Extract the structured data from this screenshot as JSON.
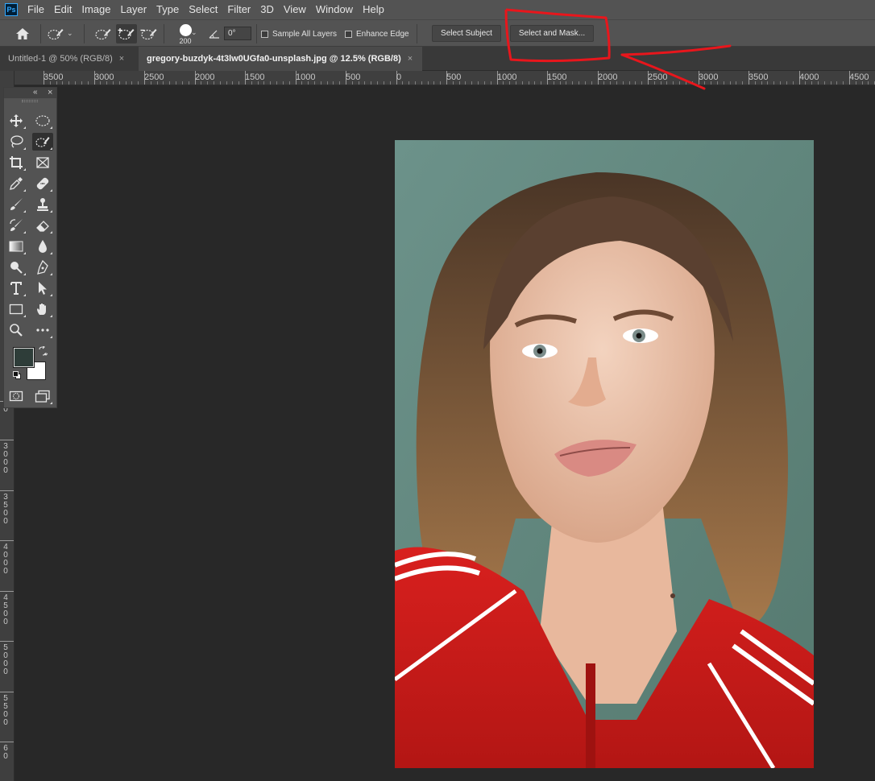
{
  "app": {
    "logo": "Ps"
  },
  "menu": [
    "File",
    "Edit",
    "Image",
    "Layer",
    "Type",
    "Select",
    "Filter",
    "3D",
    "View",
    "Window",
    "Help"
  ],
  "options": {
    "brush_size": "200",
    "angle": "0°",
    "sample_all_layers": "Sample All Layers",
    "enhance_edge": "Enhance Edge",
    "select_subject": "Select Subject",
    "select_and_mask": "Select and Mask..."
  },
  "tabs": [
    {
      "label": "Untitled-1 @ 50% (RGB/8)",
      "close": "×",
      "active": false
    },
    {
      "label": "gregory-buzdyk-4t3lw0UGfa0-unsplash.jpg @ 12.5% (RGB/8)",
      "close": "×",
      "active": true
    }
  ],
  "ruler": {
    "h_labels": [
      "3500",
      "3000",
      "2500",
      "2000",
      "1500",
      "1000",
      "500",
      "0",
      "500",
      "1000",
      "1500",
      "2000",
      "2500",
      "3000",
      "3500",
      "4000",
      "4500"
    ],
    "v_labels": [
      "0",
      "3000",
      "3500",
      "4000",
      "4500",
      "5000",
      "5500",
      "60"
    ]
  },
  "toolbox": {
    "collapse": "«",
    "close": "×"
  },
  "colors": {
    "foreground": "#2e3d39",
    "background": "#ffffff",
    "annotation": "#e8161c"
  },
  "icons": {
    "home": "home-icon",
    "quick-select": "quick-selection-icon"
  }
}
